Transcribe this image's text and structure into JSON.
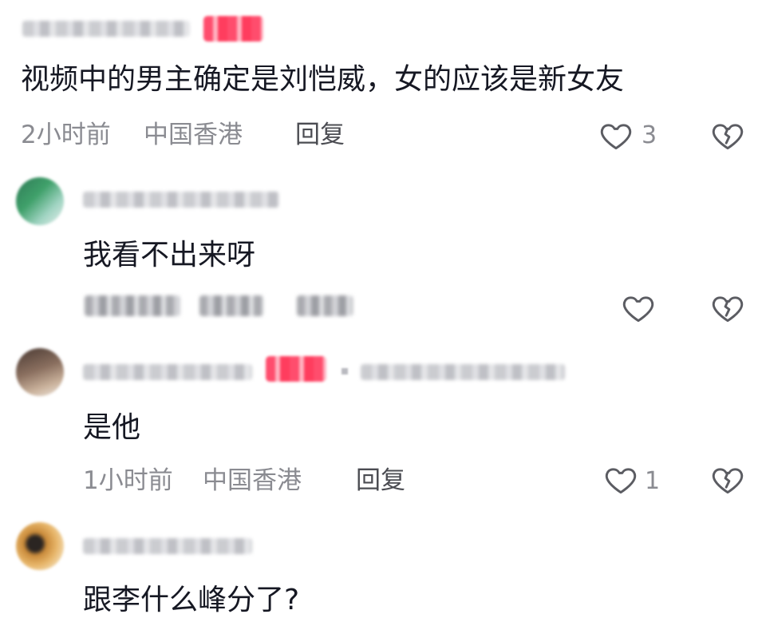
{
  "comments": [
    {
      "text": "视频中的男主确定是刘恺威，女的应该是新女友",
      "time": "2小时前",
      "location": "中国香港",
      "reply": "回复",
      "likes": "3"
    },
    {
      "text": "我看不出来呀",
      "likes": ""
    },
    {
      "text": "是他",
      "time": "1小时前",
      "location": "中国香港",
      "reply": "回复",
      "likes": "1"
    },
    {
      "text": "跟李什么峰分了?"
    }
  ],
  "icons": {
    "like": "heart-outline-icon",
    "dislike": "broken-heart-icon"
  },
  "colors": {
    "primary_text": "#161823",
    "secondary_text": "#8a8b91",
    "tag_red": "#ff4d6d",
    "background": "#ffffff"
  }
}
